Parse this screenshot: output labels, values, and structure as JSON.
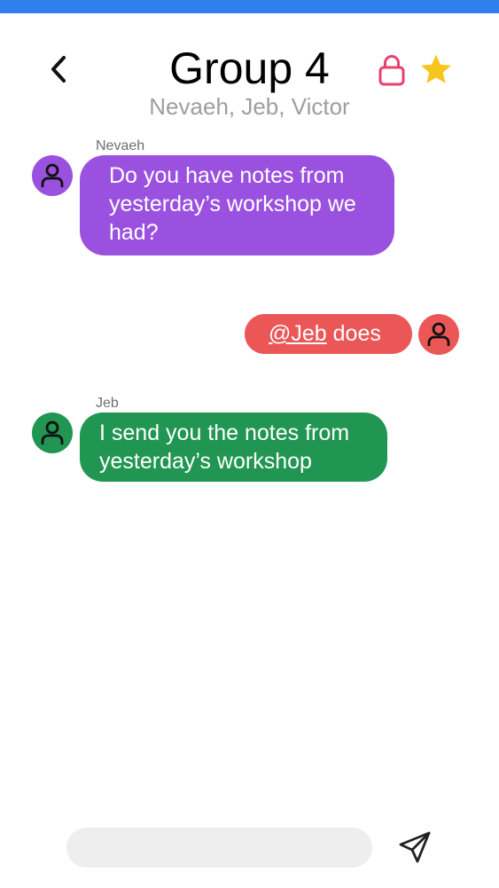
{
  "colors": {
    "topbar": "#2f80ed",
    "nevaeh": "#9b51e0",
    "self": "#eb5757",
    "jeb": "#219653",
    "lock": "#e8416f",
    "star": "#f7c51e"
  },
  "header": {
    "back_icon": "chevron-left-icon",
    "title": "Group 4",
    "subtitle": "Nevaeh, Jeb, Victor",
    "lock_icon": "lock-icon",
    "star_icon": "star-icon"
  },
  "messages": [
    {
      "sender": "Nevaeh",
      "text": "Do you have notes from yesterday’s workshop we had?",
      "avatar_icon": "person-icon"
    },
    {
      "sender": "",
      "mention": "@Jeb",
      "text": " does",
      "avatar_icon": "person-icon"
    },
    {
      "sender": "Jeb",
      "text": "I send you the notes from yesterday’s workshop",
      "avatar_icon": "person-icon"
    }
  ],
  "composer": {
    "value": "",
    "placeholder": "",
    "send_icon": "send-icon"
  }
}
